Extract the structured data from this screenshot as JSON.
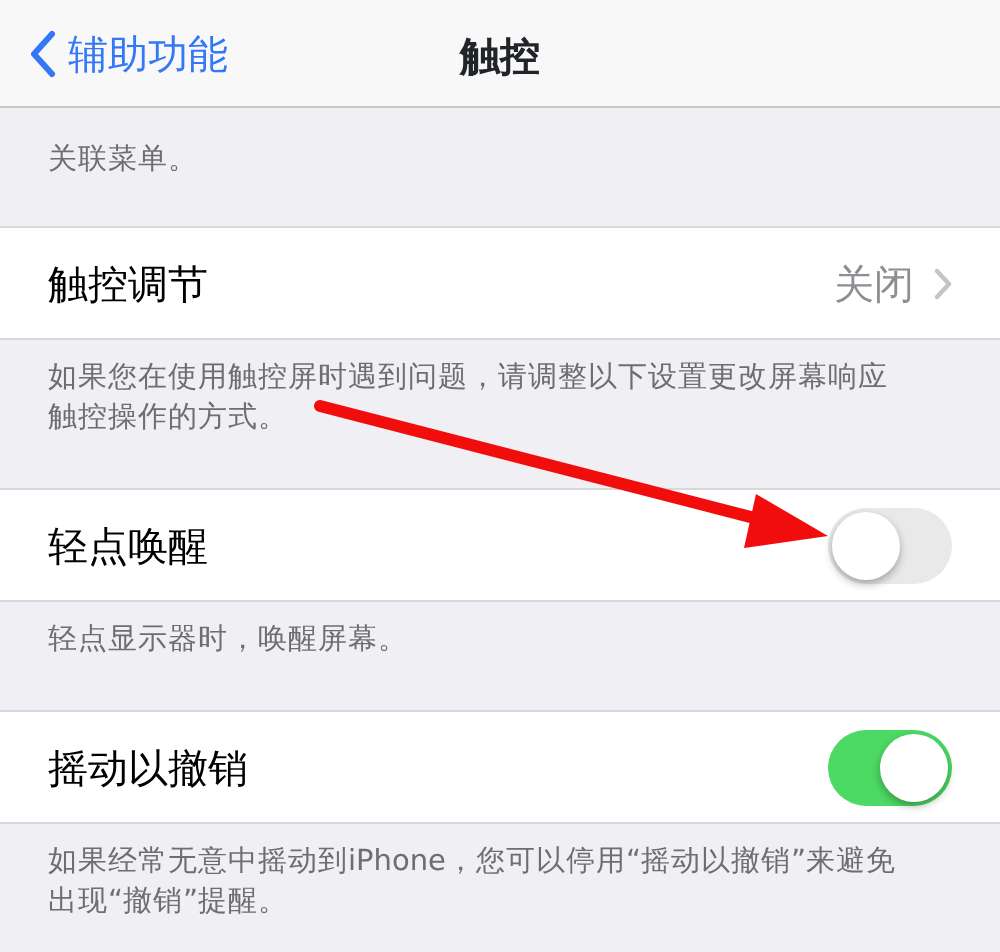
{
  "nav_bar": {
    "back_label": "辅助功能",
    "title": "触控"
  },
  "intro_text": "关联菜单。",
  "groups": [
    {
      "kind": "disclosure",
      "label": "触控调节",
      "value": "关闭",
      "footer": "如果您在使用触控屏时遇到问题，请调整以下设置更改屏幕响应触控操作的方式。"
    },
    {
      "kind": "toggle",
      "label": "轻点唤醒",
      "on": false,
      "footer": "轻点显示器时，唤醒屏幕。"
    },
    {
      "kind": "toggle",
      "label": "摇动以撤销",
      "on": true,
      "footer": "如果经常无意中摇动到iPhone，您可以停用“摇动以撤销”来避免出现“撤销”提醒。"
    }
  ]
}
